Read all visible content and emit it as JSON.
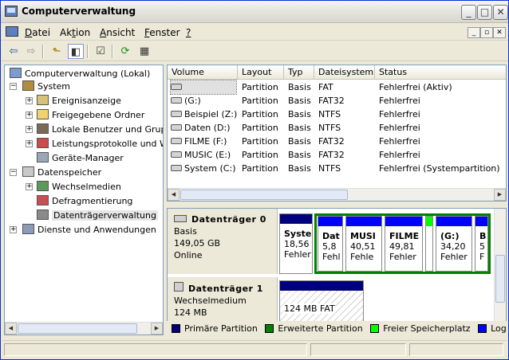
{
  "window": {
    "title": "Computerverwaltung"
  },
  "menu": {
    "items": [
      {
        "pre": "",
        "key": "D",
        "post": "atei"
      },
      {
        "pre": "Ak",
        "key": "t",
        "post": "ion"
      },
      {
        "pre": "",
        "key": "A",
        "post": "nsicht"
      },
      {
        "pre": "",
        "key": "F",
        "post": "enster"
      },
      {
        "pre": "",
        "key": "?",
        "post": ""
      }
    ]
  },
  "toolbar": {
    "icons": [
      "back-arrow-icon",
      "forward-arrow-icon",
      "up-folder-icon",
      "show-tree-icon",
      "properties-icon",
      "refresh-icon",
      "help-icon"
    ]
  },
  "tree": {
    "root": "Computerverwaltung (Lokal)",
    "system": "System",
    "system_children": [
      "Ereignisanzeige",
      "Freigegebene Ordner",
      "Lokale Benutzer und Gruppen",
      "Leistungsprotokolle und Warnungen",
      "Geräte-Manager"
    ],
    "storage": "Datenspeicher",
    "storage_children": [
      "Wechselmedien",
      "Defragmentierung",
      "Datenträgerverwaltung"
    ],
    "services": "Dienste und Anwendungen"
  },
  "volumes": {
    "headers": [
      "Volume",
      "Layout",
      "Typ",
      "Dateisystem",
      "Status"
    ],
    "rows": [
      {
        "name": "",
        "layout": "Partition",
        "type": "Basis",
        "fs": "FAT",
        "status": "Fehlerfrei (Aktiv)"
      },
      {
        "name": "(G:)",
        "layout": "Partition",
        "type": "Basis",
        "fs": "FAT32",
        "status": "Fehlerfrei"
      },
      {
        "name": "Beispiel (Z:)",
        "layout": "Partition",
        "type": "Basis",
        "fs": "NTFS",
        "status": "Fehlerfrei"
      },
      {
        "name": "Daten (D:)",
        "layout": "Partition",
        "type": "Basis",
        "fs": "NTFS",
        "status": "Fehlerfrei"
      },
      {
        "name": "FILME (F:)",
        "layout": "Partition",
        "type": "Basis",
        "fs": "FAT32",
        "status": "Fehlerfrei"
      },
      {
        "name": "MUSIC (E:)",
        "layout": "Partition",
        "type": "Basis",
        "fs": "FAT32",
        "status": "Fehlerfrei"
      },
      {
        "name": "System (C:)",
        "layout": "Partition",
        "type": "Basis",
        "fs": "NTFS",
        "status": "Fehlerfrei (Systempartition)"
      }
    ]
  },
  "disks": [
    {
      "name": "Datenträger 0",
      "kind": "Basis",
      "size": "149,05 GB",
      "state": "Online",
      "partitions": [
        {
          "l1": "Syste",
          "l2": "18,56",
          "l3": "Fehler"
        },
        {
          "l1": "Dat",
          "l2": "5,8",
          "l3": "Fehl"
        },
        {
          "l1": "MUSI",
          "l2": "40,51",
          "l3": "Fehle"
        },
        {
          "l1": "FILME",
          "l2": "49,81",
          "l3": "Fehler"
        },
        {
          "l1": "(G:)",
          "l2": "34,20",
          "l3": "Fehler"
        },
        {
          "l1": "B",
          "l2": "5",
          "l3": "F"
        }
      ]
    },
    {
      "name": "Datenträger 1",
      "kind": "Wechselmedium",
      "size": "124 MB",
      "partitions": [
        {
          "l1": "124 MB FAT"
        }
      ]
    }
  ],
  "legend": [
    {
      "label": "Primäre Partition",
      "color": "#00007f"
    },
    {
      "label": "Erweiterte Partition",
      "color": "#008000"
    },
    {
      "label": "Freier Speicherplatz",
      "color": "#00ff00"
    },
    {
      "label": "Logisches Laufwerk",
      "color": "#0000ff"
    }
  ]
}
